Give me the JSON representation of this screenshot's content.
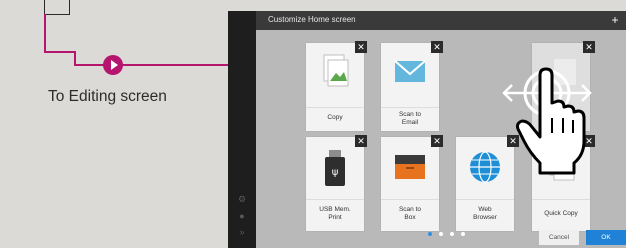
{
  "annotation": {
    "caption": "To Editing screen",
    "accent": "#b5156e"
  },
  "screen": {
    "title": "Customize Home screen",
    "tiles": [
      {
        "label": "Copy",
        "icon": "copy-icon"
      },
      {
        "label": "Scan to\nEmail",
        "icon": "email-icon"
      },
      {
        "label": "",
        "icon": "blank-tile"
      },
      {
        "label": "USB Mem.\nPrint",
        "icon": "usb-icon"
      },
      {
        "label": "Scan to\nBox",
        "icon": "box-icon"
      },
      {
        "label": "Web\nBrowser",
        "icon": "globe-icon"
      },
      {
        "label": "Quick Copy",
        "icon": "quick-copy-icon"
      }
    ],
    "buttons": {
      "cancel": "Cancel",
      "ok": "OK"
    },
    "page_indicator": {
      "pages": 4,
      "current": 1
    },
    "colors": {
      "ok": "#1f82d6",
      "topbar": "#3a3a3a"
    }
  }
}
